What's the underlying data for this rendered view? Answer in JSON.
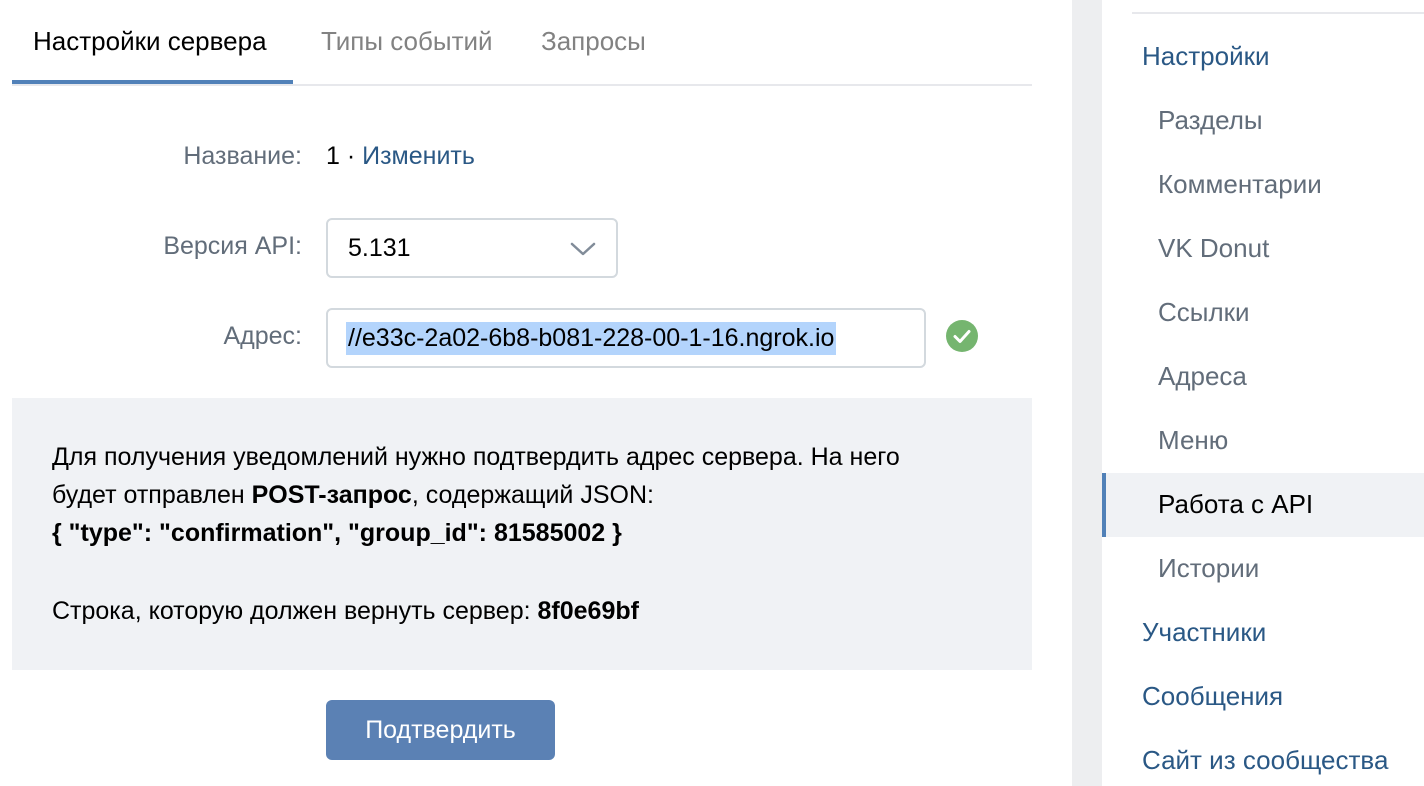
{
  "tabs": [
    {
      "label": "Настройки сервера",
      "active": true
    },
    {
      "label": "Типы событий",
      "active": false
    },
    {
      "label": "Запросы",
      "active": false
    }
  ],
  "form": {
    "name_label": "Название:",
    "name_value": "1 · ",
    "name_change_link": "Изменить",
    "api_label": "Версия API:",
    "api_version": "5.131",
    "address_label": "Адрес:",
    "address_value": "//e33c-2a02-6b8-b081-228-00-1-16.ngrok.io",
    "address_status_icon": "check-circle-icon",
    "status_color": "#75b56f"
  },
  "info": {
    "line1": "Для получения уведомлений нужно подтвердить адрес сервера. На него",
    "line2_pre": "будет отправлен ",
    "line2_bold": "POST-запрос",
    "line2_post": ", содержащий JSON:",
    "line3_json": "{ \"type\": \"confirmation\", \"group_id\": 81585002 }",
    "line4_pre": "Строка, которую должен вернуть сервер: ",
    "line4_code": "8f0e69bf"
  },
  "confirm_button": "Подтвердить",
  "sidebar": {
    "items": [
      {
        "label": "Настройки",
        "level": "top",
        "selected": false
      },
      {
        "label": "Разделы",
        "level": "sub",
        "selected": false
      },
      {
        "label": "Комментарии",
        "level": "sub",
        "selected": false
      },
      {
        "label": "VK Donut",
        "level": "sub",
        "selected": false
      },
      {
        "label": "Ссылки",
        "level": "sub",
        "selected": false
      },
      {
        "label": "Адреса",
        "level": "sub",
        "selected": false
      },
      {
        "label": "Меню",
        "level": "sub",
        "selected": false
      },
      {
        "label": "Работа с API",
        "level": "sub",
        "selected": true
      },
      {
        "label": "Истории",
        "level": "sub",
        "selected": false
      },
      {
        "label": "Участники",
        "level": "top",
        "selected": false
      },
      {
        "label": "Сообщения",
        "level": "top",
        "selected": false
      },
      {
        "label": "Сайт из сообщества",
        "level": "top",
        "selected": false
      }
    ]
  },
  "colors": {
    "accent": "#5181b8",
    "link": "#2a5885",
    "button": "#5b81b4",
    "info_bg": "#f0f2f5"
  }
}
